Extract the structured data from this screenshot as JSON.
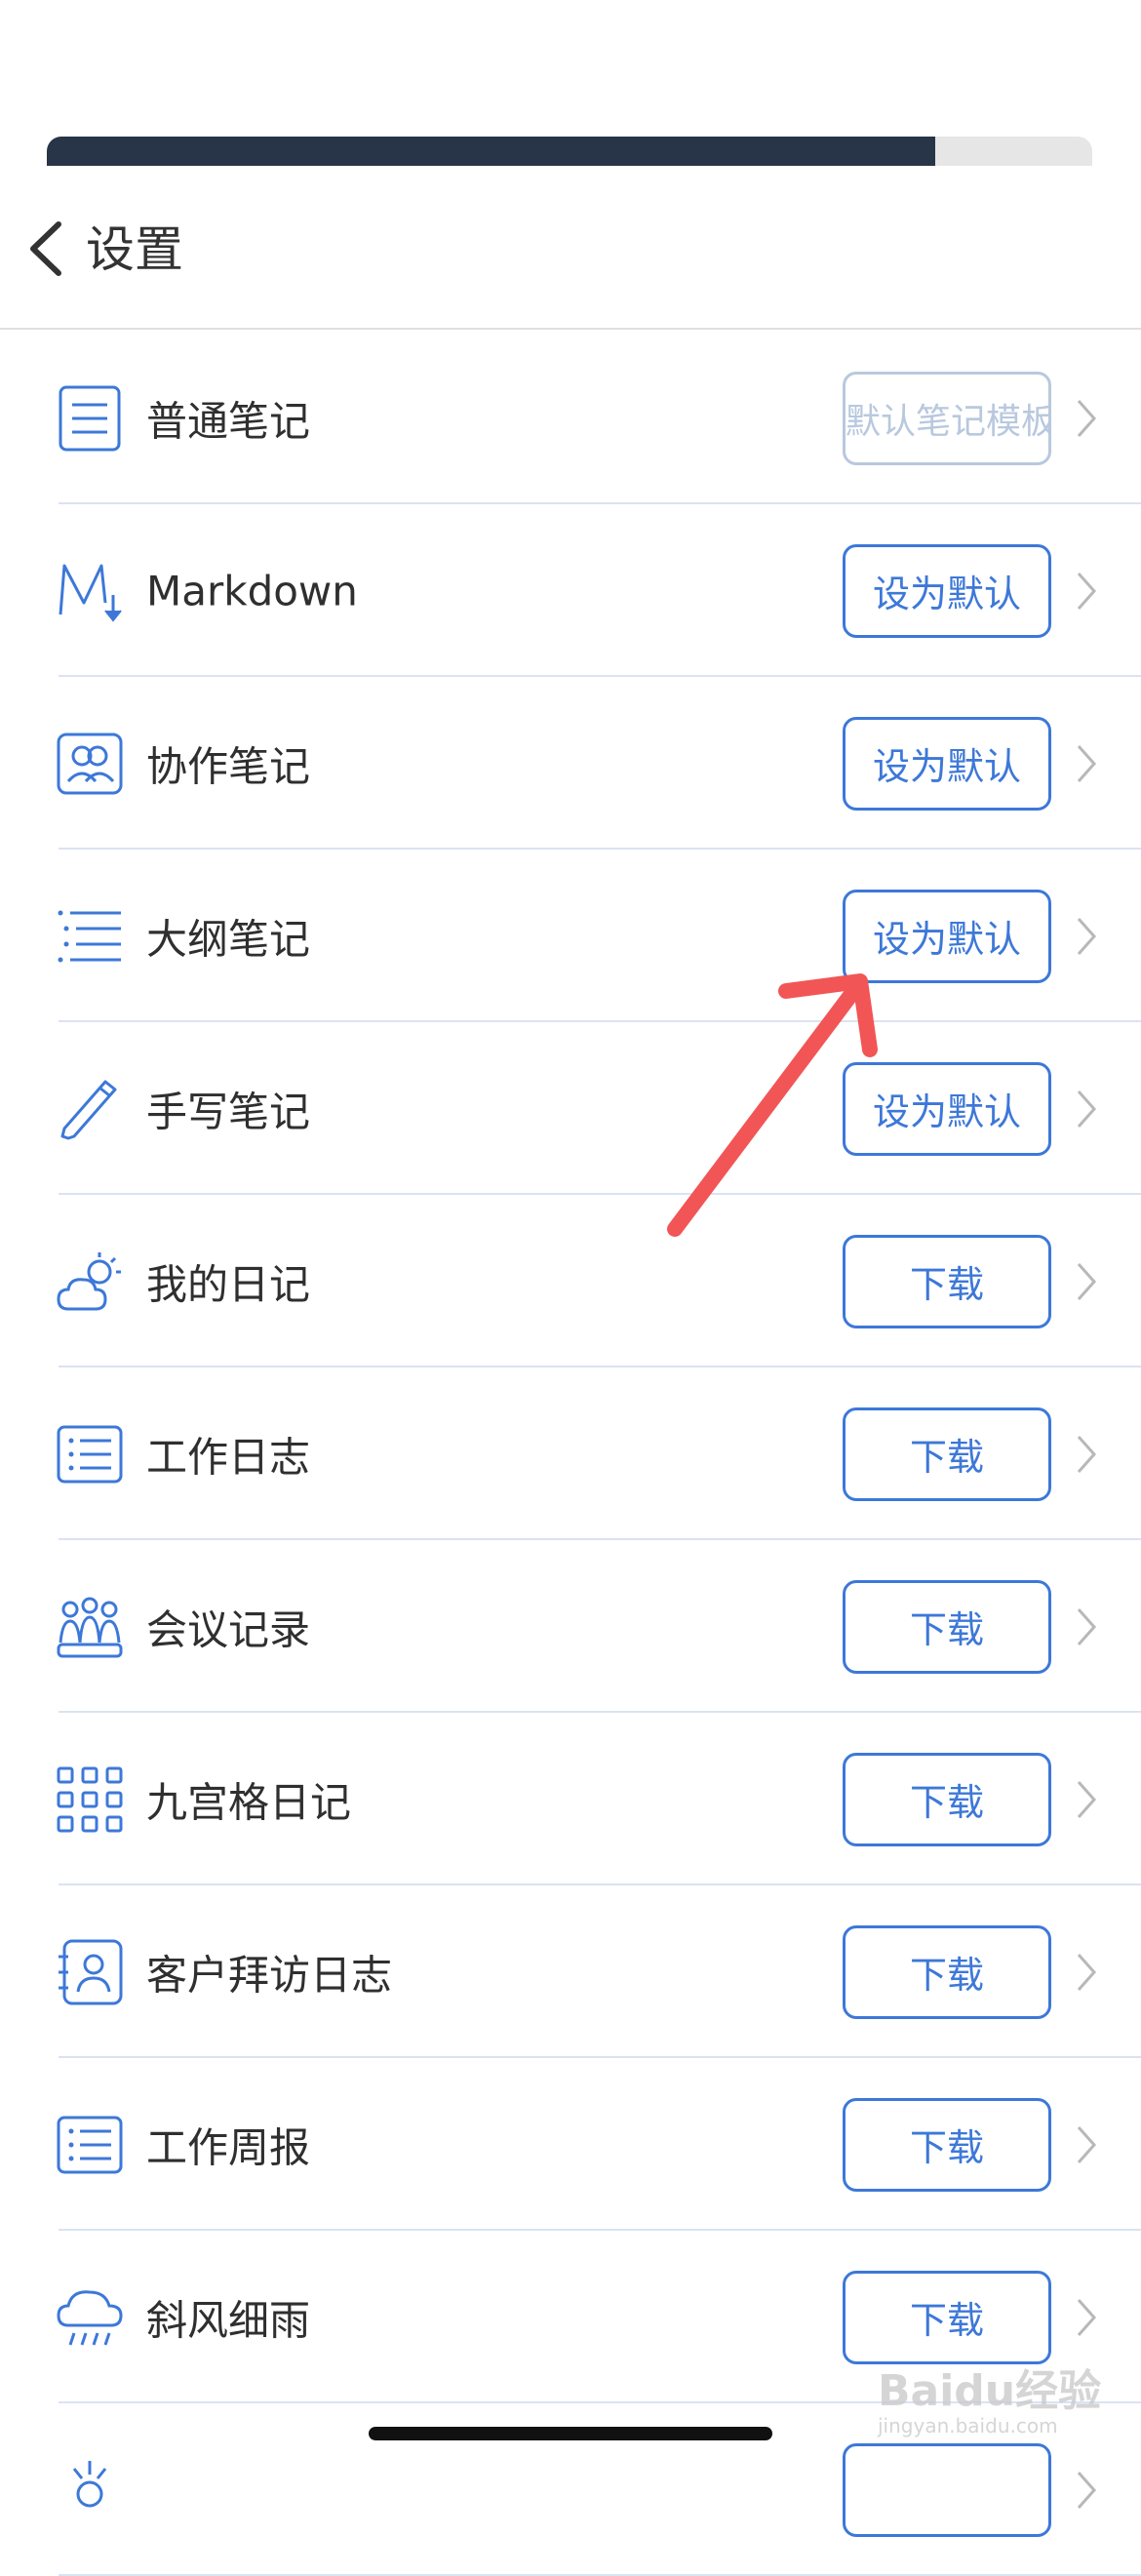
{
  "header": {
    "title": "设置",
    "progress_percent": 85
  },
  "colors": {
    "accent": "#3d78d8",
    "muted": "#b8c8de",
    "progress": "#283548"
  },
  "items": [
    {
      "icon": "document-icon",
      "label": "普通笔记",
      "button": "默认笔记模板",
      "muted": true
    },
    {
      "icon": "markdown-icon",
      "label": "Markdown",
      "button": "设为默认"
    },
    {
      "icon": "collaboration-icon",
      "label": "协作笔记",
      "button": "设为默认"
    },
    {
      "icon": "outline-icon",
      "label": "大纲笔记",
      "button": "设为默认"
    },
    {
      "icon": "pen-icon",
      "label": "手写笔记",
      "button": "设为默认"
    },
    {
      "icon": "weather-icon",
      "label": "我的日记",
      "button": "下载"
    },
    {
      "icon": "list-icon",
      "label": "工作日志",
      "button": "下载"
    },
    {
      "icon": "meeting-icon",
      "label": "会议记录",
      "button": "下载"
    },
    {
      "icon": "grid-icon",
      "label": "九宫格日记",
      "button": "下载"
    },
    {
      "icon": "client-icon",
      "label": "客户拜访日志",
      "button": "下载"
    },
    {
      "icon": "list-icon",
      "label": "工作周报",
      "button": "下载"
    },
    {
      "icon": "rain-icon",
      "label": "斜风细雨",
      "button": "下载"
    },
    {
      "icon": "sun-icon",
      "label": "",
      "button": ""
    }
  ],
  "watermark": {
    "brand": "Baidu经验",
    "url": "jingyan.baidu.com"
  }
}
